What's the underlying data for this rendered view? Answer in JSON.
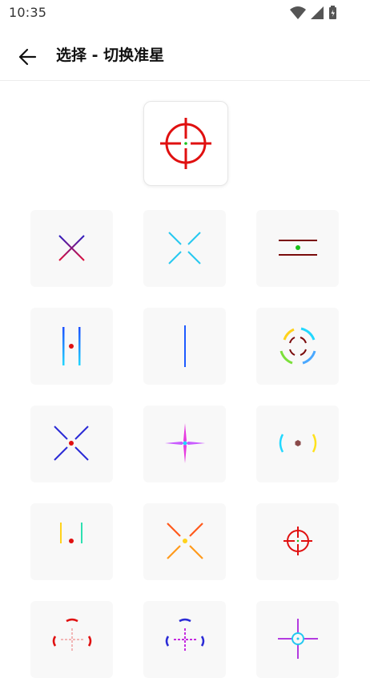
{
  "status_bar": {
    "time": "10:35",
    "icons": [
      "wifi-icon",
      "signal-icon",
      "battery-icon"
    ]
  },
  "header": {
    "back_icon": "arrow-left-icon",
    "title": "选择 - 切换准星"
  },
  "selected_crosshair": "red-circle-scope-crosshair",
  "crosshair_options": [
    "purple-red-x-crosshair",
    "cyan-split-x-crosshair",
    "dark-red-double-line-crosshair",
    "blue-vertical-bars-crosshair",
    "blue-plus-crosshair",
    "rainbow-ring-crosshair",
    "blue-x-red-dot-crosshair",
    "magenta-star-crosshair",
    "cyan-yellow-bracket-crosshair",
    "yellow-green-h-crosshair",
    "orange-x-crosshair",
    "red-scope-small-crosshair",
    "red-arc-dotted-crosshair",
    "purple-arc-dotted-crosshair",
    "violet-circle-plus-crosshair"
  ],
  "colors": {
    "selected": "#e01010",
    "tile_background": "#f8f8f8"
  }
}
